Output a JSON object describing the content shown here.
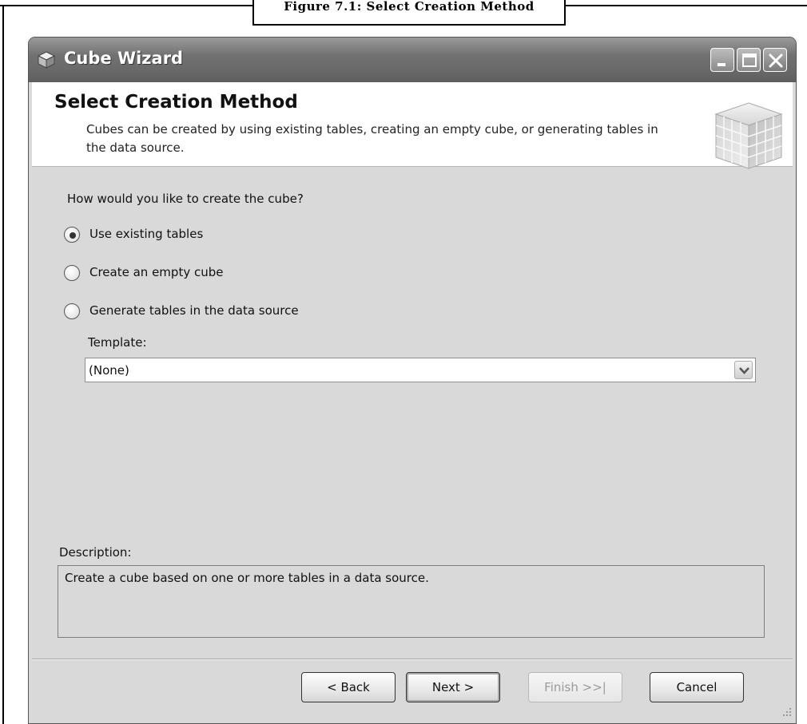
{
  "figure": {
    "caption": "Figure 7.1: Select Creation Method"
  },
  "window": {
    "title": "Cube Wizard",
    "icon": "cube-icon"
  },
  "header": {
    "title": "Select Creation Method",
    "description": "Cubes can be created by using existing tables, creating an empty cube, or generating tables in the data source.",
    "graphic": "cube-graphic"
  },
  "body": {
    "question": "How would you like to create the cube?",
    "options": [
      {
        "label": "Use existing tables",
        "selected": true
      },
      {
        "label": "Create an empty cube",
        "selected": false
      },
      {
        "label": "Generate tables in the data source",
        "selected": false
      }
    ],
    "template_label": "Template:",
    "template_value": "(None)",
    "description_label": "Description:",
    "description_text": "Create a cube based on one or more tables in a data source."
  },
  "buttons": {
    "back": "< Back",
    "next": "Next >",
    "finish": "Finish >>|",
    "cancel": "Cancel"
  }
}
